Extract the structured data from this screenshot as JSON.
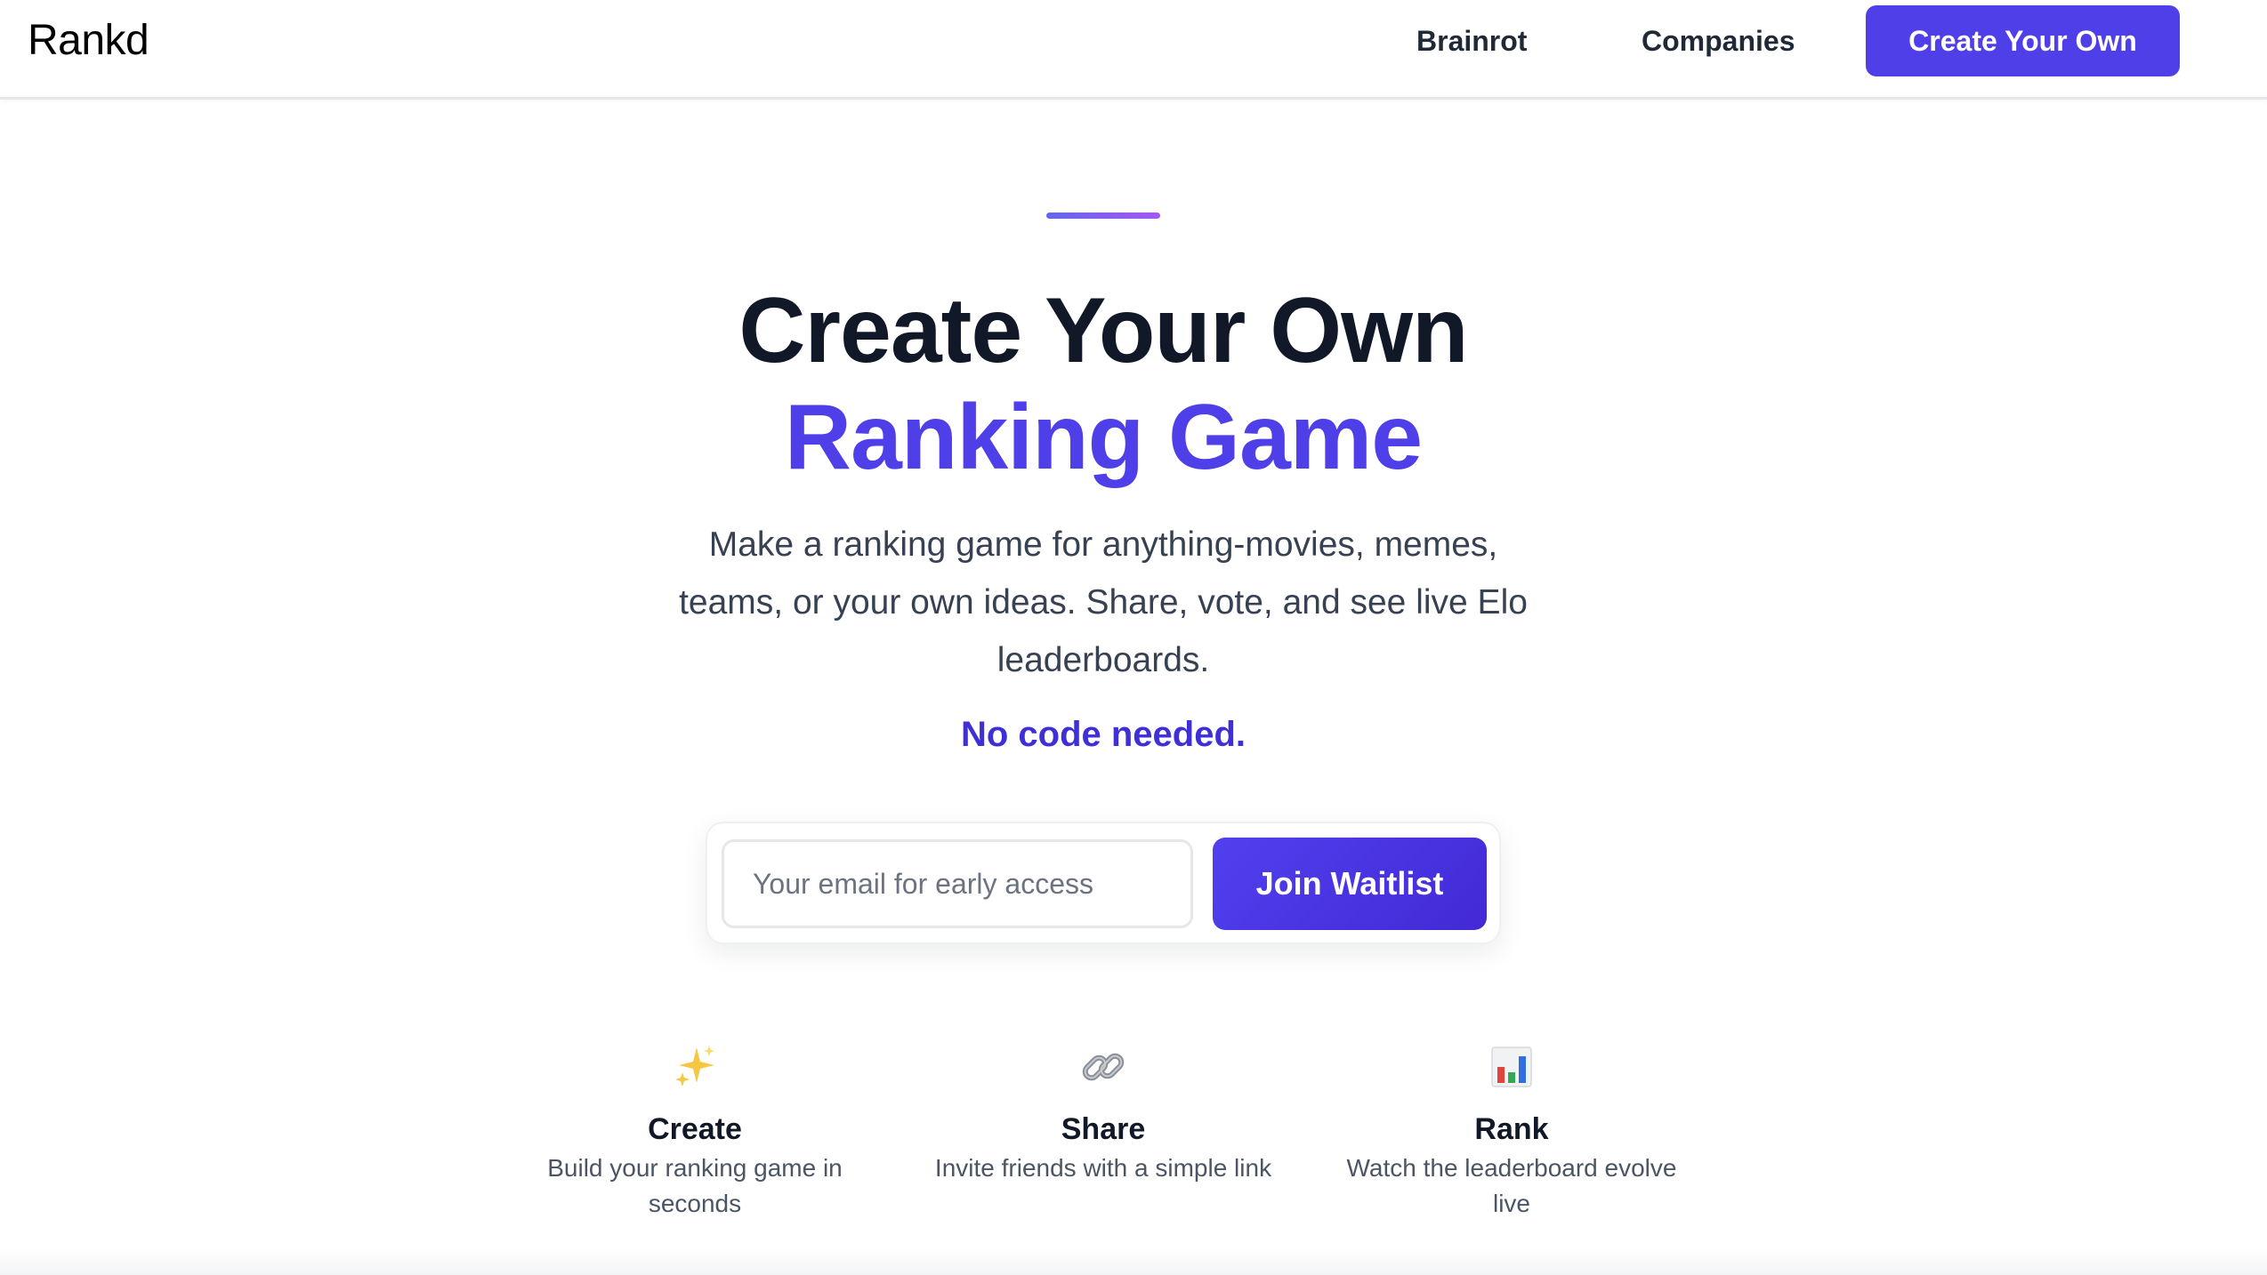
{
  "header": {
    "logo": "Rankd",
    "nav": {
      "brainrot": "Brainrot",
      "companies": "Companies",
      "cta": "Create Your Own"
    }
  },
  "hero": {
    "title_line1": "Create Your Own",
    "title_line2": "Ranking Game",
    "subtitle": "Make a ranking game for anything-movies, memes, teams, or your own ideas. Share, vote, and see live Elo leaderboards.",
    "no_code": "No code needed."
  },
  "waitlist": {
    "email_placeholder": "Your email for early access",
    "email_value": "",
    "button_label": "Join Waitlist"
  },
  "features": [
    {
      "icon": "sparkles-icon",
      "title": "Create",
      "description": "Build your ranking game in seconds"
    },
    {
      "icon": "link-icon",
      "title": "Share",
      "description": "Invite friends with a simple link"
    },
    {
      "icon": "bar-chart-icon",
      "title": "Rank",
      "description": "Watch the leaderboard evolve live"
    }
  ],
  "colors": {
    "accent": "#4f3fe8",
    "heading": "#111827",
    "body_text": "#374151",
    "no_code": "#3f2fd6"
  }
}
